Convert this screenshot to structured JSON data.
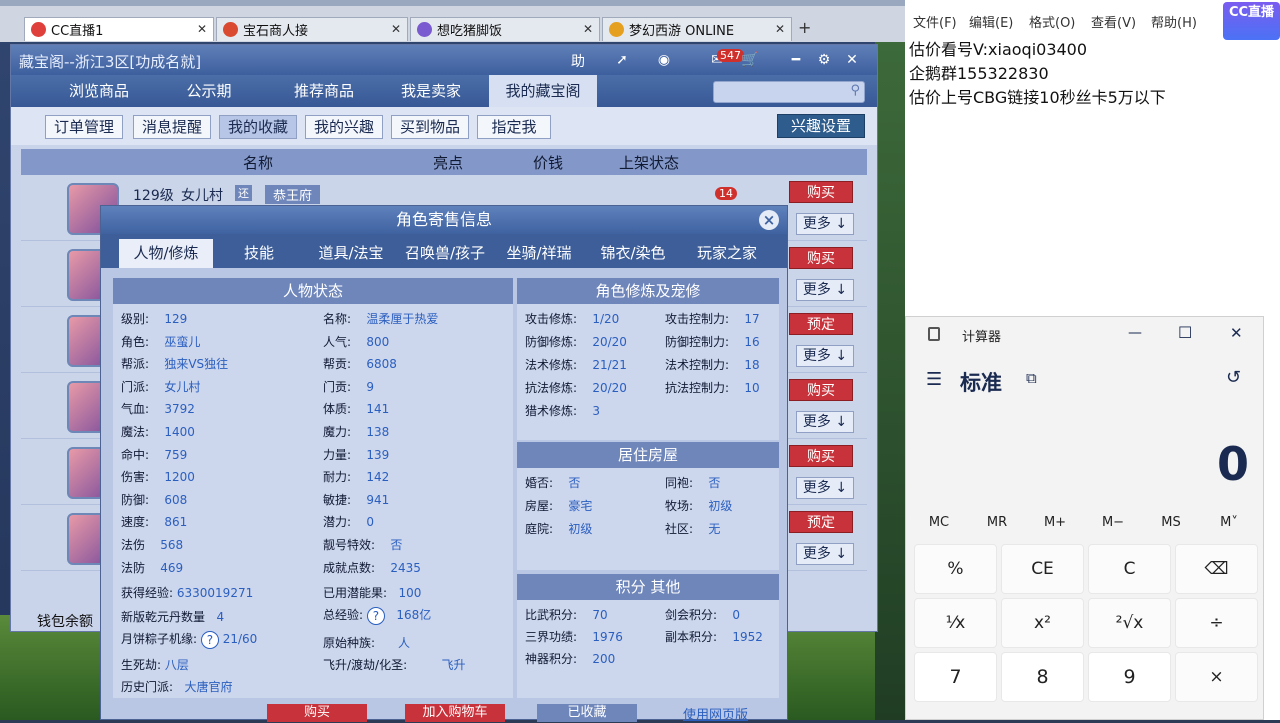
{
  "browser": {
    "tabs": [
      {
        "label": "CC直播1",
        "icon": "cc-icon",
        "active": true
      },
      {
        "label": "宝石商人接",
        "icon": "game-icon"
      },
      {
        "label": "想吃猪脚饭",
        "icon": "game-icon"
      },
      {
        "label": "梦幻西游 ONLINE",
        "icon": "game-icon"
      }
    ],
    "new_tab": "+"
  },
  "cbg": {
    "title": "藏宝阁--浙江3区[功成名就]",
    "help": "助",
    "message_count": "547",
    "nav": [
      "浏览商品",
      "公示期",
      "推荐商品",
      "我是卖家",
      "我的藏宝阁"
    ],
    "sub_nav": [
      "订单管理",
      "消息提醒",
      "我的收藏",
      "我的兴趣",
      "买到物品",
      "指定我"
    ],
    "interest_btn": "兴趣设置",
    "list_header": {
      "name": "名称",
      "highlight": "亮点",
      "price": "价钱",
      "status": "上架状态"
    },
    "first_row": {
      "level": "129级",
      "school": "女儿村",
      "tag1": "还",
      "tag2": "恭王府",
      "badge": "14"
    },
    "row_buttons": [
      "购买",
      "购买",
      "预定",
      "购买",
      "购买",
      "预定"
    ],
    "more_label": "更多 ↓",
    "wallet": "钱包余额"
  },
  "dialog": {
    "title": "角色寄售信息",
    "close": "×",
    "tabs": [
      "人物/修炼",
      "技能",
      "道具/法宝",
      "召唤兽/孩子",
      "坐骑/祥瑞",
      "锦衣/染色",
      "玩家之家"
    ],
    "status_title": "人物状态",
    "status_left": [
      {
        "k": "级别:",
        "v": "129"
      },
      {
        "k": "角色:",
        "v": "巫蛮儿"
      },
      {
        "k": "帮派:",
        "v": "独来VS独往"
      },
      {
        "k": "门派:",
        "v": "女儿村"
      },
      {
        "k": "气血:",
        "v": "3792"
      },
      {
        "k": "魔法:",
        "v": "1400"
      },
      {
        "k": "命中:",
        "v": "759"
      },
      {
        "k": "伤害:",
        "v": "1200"
      },
      {
        "k": "防御:",
        "v": "608"
      },
      {
        "k": "速度:",
        "v": "861"
      },
      {
        "k": "法伤",
        "v": "568"
      },
      {
        "k": "法防",
        "v": "469"
      }
    ],
    "status_right": [
      {
        "k": "名称:",
        "v": "温柔厘于热爱"
      },
      {
        "k": "人气:",
        "v": "800"
      },
      {
        "k": "帮贡:",
        "v": "6808"
      },
      {
        "k": "门贡:",
        "v": "9"
      },
      {
        "k": "体质:",
        "v": "141"
      },
      {
        "k": "魔力:",
        "v": "138"
      },
      {
        "k": "力量:",
        "v": "139"
      },
      {
        "k": "耐力:",
        "v": "142"
      },
      {
        "k": "敏捷:",
        "v": "941"
      },
      {
        "k": "潜力:",
        "v": "0"
      },
      {
        "k": "靓号特效:",
        "v": "否"
      },
      {
        "k": "成就点数:",
        "v": "2435"
      }
    ],
    "extra": {
      "exp_k": "获得经验:",
      "exp_v": "6330019271",
      "potential_k": "已用潜能果:",
      "potential_v": "100",
      "qian_k": "新版乾元丹数量",
      "qian_v": "4",
      "total_exp_k": "总经验:",
      "total_exp_v": "168亿",
      "moon_k": "月饼粽子机缘:",
      "moon_v": "21/60",
      "race_k": "原始种族:",
      "race_v": "人",
      "life_k": "生死劫:",
      "life_v": "八层",
      "ascend_k": "飞升/渡劫/化圣:",
      "ascend_v": "飞升",
      "history_k": "历史门派:",
      "history_v": "大唐官府",
      "question": "?"
    },
    "cultivation_title": "角色修炼及宠修",
    "cultivation_left": [
      {
        "k": "攻击修炼:",
        "v": "1/20"
      },
      {
        "k": "防御修炼:",
        "v": "20/20"
      },
      {
        "k": "法术修炼:",
        "v": "21/21"
      },
      {
        "k": "抗法修炼:",
        "v": "20/20"
      },
      {
        "k": "猎术修炼:",
        "v": "3"
      }
    ],
    "cultivation_right": [
      {
        "k": "攻击控制力:",
        "v": "17"
      },
      {
        "k": "防御控制力:",
        "v": "16"
      },
      {
        "k": "法术控制力:",
        "v": "18"
      },
      {
        "k": "抗法控制力:",
        "v": "10"
      }
    ],
    "house_title": "居住房屋",
    "house": [
      {
        "k": "婚否:",
        "v": "否"
      },
      {
        "k": "同袍:",
        "v": "否"
      },
      {
        "k": "房屋:",
        "v": "豪宅"
      },
      {
        "k": "牧场:",
        "v": "初级"
      },
      {
        "k": "庭院:",
        "v": "初级"
      },
      {
        "k": "社区:",
        "v": "无"
      }
    ],
    "score_title": "积分 其他",
    "score": [
      {
        "k": "比武积分:",
        "v": "70"
      },
      {
        "k": "剑会积分:",
        "v": "0"
      },
      {
        "k": "三界功绩:",
        "v": "1976"
      },
      {
        "k": "副本积分:",
        "v": "1952"
      },
      {
        "k": "神器积分:",
        "v": "200"
      }
    ],
    "footer": [
      "购买",
      "加入购物车",
      "已收藏",
      "使用网页版"
    ]
  },
  "notepad": {
    "menu": [
      "文件(F)",
      "编辑(E)",
      "格式(O)",
      "查看(V)",
      "帮助(H)"
    ],
    "lines": [
      "估价看号V:xiaoqi03400",
      "企鹅群155322830",
      "估价上号CBG链接10秒丝卡5万以下"
    ],
    "badge": "CC直播"
  },
  "calculator": {
    "title": "计算器",
    "mode": "标准",
    "display": "0",
    "memory": [
      "MC",
      "MR",
      "M+",
      "M−",
      "MS",
      "M˅"
    ],
    "keys": [
      "%",
      "CE",
      "C",
      "⌫",
      "¹⁄x",
      "x²",
      "²√x",
      "÷",
      "7",
      "8",
      "9",
      "×"
    ],
    "min": "—",
    "max": "☐",
    "close": "✕"
  },
  "colors": {
    "accent": "#3d5f9d",
    "buy": "#c8323a",
    "value": "#2b5fbf"
  }
}
